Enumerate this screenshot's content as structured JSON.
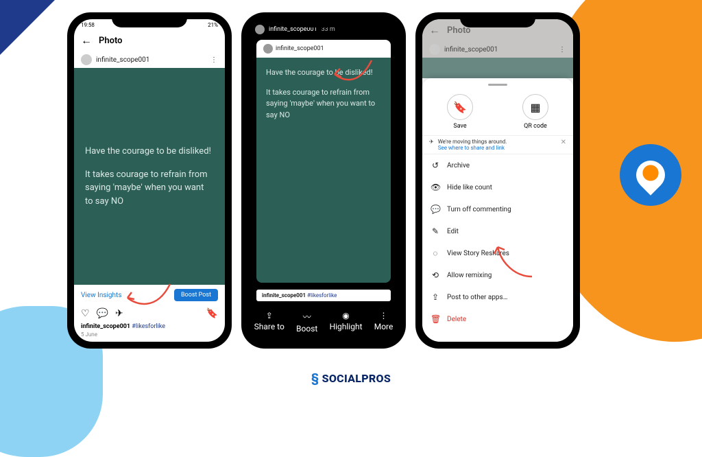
{
  "decor": {
    "logo_text": "SOCIALPROS"
  },
  "phone1": {
    "status_time": "19:58",
    "status_right": "21%",
    "header": "Photo",
    "username": "infinite_scope001",
    "post_line1": "Have the courage to be disliked!",
    "post_line2": "It takes courage to refrain from saying 'maybe' when you want to say NO",
    "view_insights": "View Insights",
    "boost": "Boost Post",
    "caption_user": "infinite_scope001",
    "caption_hashtag": "#likesforlike",
    "date": "5 June"
  },
  "phone2": {
    "username": "infinite_scope001",
    "time": "33 m",
    "label_user": "infinite_scope001",
    "post_line1": "Have the courage to be disliked!",
    "post_line2": "It takes courage to refrain from saying 'maybe' when you want to say NO",
    "caption_user": "infinite_scope001",
    "caption_hashtag": "#likesforlike",
    "share": "Share to",
    "boost": "Boost",
    "highlight": "Highlight",
    "more": "More"
  },
  "phone3": {
    "header": "Photo",
    "username": "infinite_scope001",
    "save": "Save",
    "qr": "QR code",
    "notice_line1": "We're moving things around.",
    "notice_line2": "See where to share and link",
    "menu": {
      "archive": "Archive",
      "hide_likes": "Hide like count",
      "turn_off_commenting": "Turn off commenting",
      "edit": "Edit",
      "view_reshares": "View Story Reshares",
      "allow_remixing": "Allow remixing",
      "post_other": "Post to other apps…",
      "delete": "Delete"
    }
  }
}
